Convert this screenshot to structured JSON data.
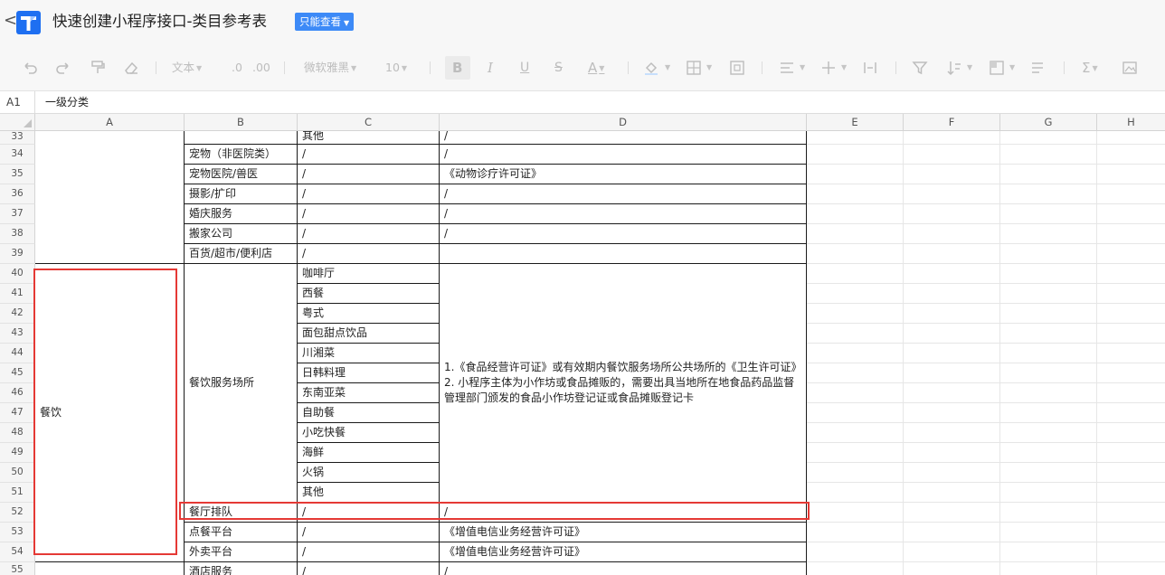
{
  "app": {
    "back_glyph": "<",
    "title": "快速创建小程序接口-类目参考表",
    "badge": "只能查看"
  },
  "toolbar": {
    "font_type_label": "文本",
    "dec_decrease_label": ".0",
    "dec_increase_label": ".00",
    "font_name": "微软雅黑",
    "font_size": "10",
    "bold_label": "B",
    "italic_label": "I",
    "underline_label": "U",
    "strike_label": "S",
    "font_color_label": "A",
    "sum_label": "Σ"
  },
  "formula_bar": {
    "cell_ref": "A1",
    "value": "一级分类"
  },
  "columns": [
    "A",
    "B",
    "C",
    "D",
    "E",
    "F",
    "G",
    "H"
  ],
  "rows": [
    "33",
    "34",
    "35",
    "36",
    "37",
    "38",
    "39",
    "40",
    "41",
    "42",
    "43",
    "44",
    "45",
    "46",
    "47",
    "48",
    "49",
    "50",
    "51",
    "52",
    "53",
    "54",
    "55"
  ],
  "sheet": {
    "r33": {
      "c": "其他",
      "d": "/"
    },
    "r34": {
      "b": "宠物（非医院类）",
      "c": "/",
      "d": "/"
    },
    "r35": {
      "b": "宠物医院/兽医",
      "c": "/",
      "d": "《动物诊疗许可证》"
    },
    "r36": {
      "b": "摄影/扩印",
      "c": "/",
      "d": "/"
    },
    "r37": {
      "b": "婚庆服务",
      "c": "/",
      "d": "/"
    },
    "r38": {
      "b": "搬家公司",
      "c": "/",
      "d": "/"
    },
    "r39": {
      "b": "百货/超市/便利店",
      "c": "/"
    },
    "a_catering": "餐饮",
    "b_catering_venue": "餐饮服务场所",
    "catering_subs": [
      "咖啡厅",
      "西餐",
      "粤式",
      "面包甜点饮品",
      "川湘菜",
      "日韩料理",
      "东南亚菜",
      "自助餐",
      "小吃快餐",
      "海鲜",
      "火锅",
      "其他"
    ],
    "d_catering_note_1": "1.《食品经营许可证》或有效期内餐饮服务场所公共场所的《卫生许可证》",
    "d_catering_note_2": "2. 小程序主体为小作坊或食品摊贩的，需要出具当地所在地食品药品监督管理部门颁发的食品小作坊登记证或食品摊贩登记卡",
    "r52": {
      "b": "餐厅排队",
      "c": "/",
      "d": "/"
    },
    "r53": {
      "b": "点餐平台",
      "c": "/",
      "d": "《增值电信业务经营许可证》"
    },
    "r54": {
      "b": "外卖平台",
      "c": "/",
      "d": "《增值电信业务经营许可证》"
    },
    "r55": {
      "b": "酒店服务",
      "c": "/",
      "d": "/"
    }
  },
  "colors": {
    "highlight": "#e53935",
    "badge": "#3d8af7",
    "logo": "#1e6ff1"
  }
}
